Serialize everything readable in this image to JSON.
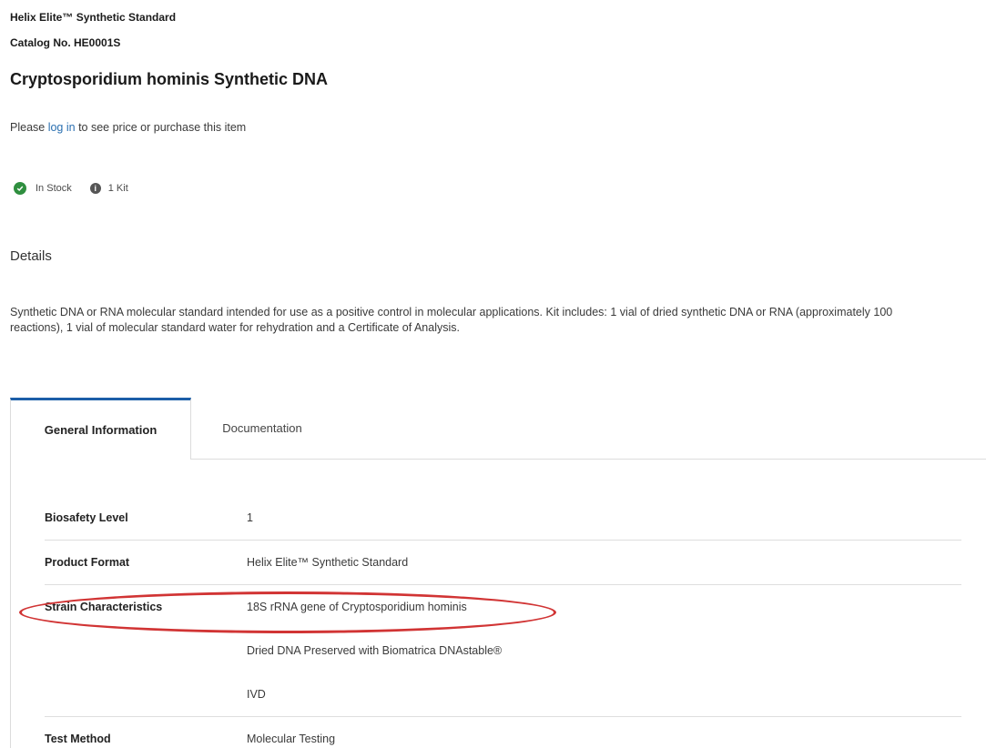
{
  "product": {
    "brand": "Helix Elite™ Synthetic Standard",
    "catalog": "Catalog No. HE0001S",
    "title": "Cryptosporidium hominis Synthetic DNA"
  },
  "login_prompt": {
    "before": "Please ",
    "link": "log in",
    "after": " to see price or purchase this item"
  },
  "stock": {
    "status": "In Stock",
    "quantity": "1 Kit",
    "status_color": "#2f8f3f"
  },
  "details": {
    "heading": "Details",
    "text": "Synthetic DNA or RNA molecular standard intended for use as a positive control in molecular applications. Kit includes: 1 vial of dried synthetic DNA or RNA (approximately 100 reactions), 1 vial of molecular standard water for rehydration and a Certificate of Analysis."
  },
  "tabs": [
    {
      "label": "General Information",
      "active": true
    },
    {
      "label": "Documentation",
      "active": false
    }
  ],
  "general_info": {
    "rows": [
      {
        "label": "Biosafety Level",
        "values": [
          "1"
        ]
      },
      {
        "label": "Product Format",
        "values": [
          "Helix Elite™ Synthetic Standard"
        ]
      },
      {
        "label": "Strain Characteristics",
        "values": [
          "18S rRNA gene of Cryptosporidium hominis",
          "Dried DNA Preserved with Biomatrica DNAstable®",
          "IVD"
        ],
        "highlighted": true
      },
      {
        "label": "Test Method",
        "values": [
          "Molecular Testing"
        ]
      }
    ]
  },
  "colors": {
    "accent": "#1c5ea8",
    "link": "#2a6fb0",
    "highlight": "#d13434"
  }
}
